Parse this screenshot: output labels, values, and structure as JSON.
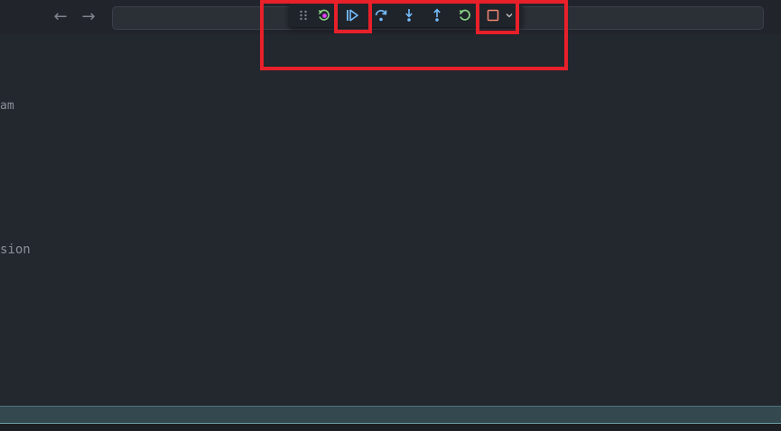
{
  "titlebar": {
    "back_icon": "arrow-left-icon",
    "forward_icon": "arrow-right-icon",
    "search_value": ""
  },
  "debug_toolbar": {
    "buttons": [
      {
        "id": "gripper",
        "icon": "gripper-dots-icon",
        "color": "#7f848e"
      },
      {
        "id": "restart-frame",
        "icon": "restart-frame-icon",
        "color": "#89d185",
        "accent": "#e040fb"
      },
      {
        "id": "continue",
        "icon": "continue-icon",
        "color": "#75beff"
      },
      {
        "id": "step-over",
        "icon": "step-over-icon",
        "color": "#75beff"
      },
      {
        "id": "step-into",
        "icon": "step-into-icon",
        "color": "#75beff"
      },
      {
        "id": "step-out",
        "icon": "step-out-icon",
        "color": "#75beff"
      },
      {
        "id": "restart",
        "icon": "restart-icon",
        "color": "#89d185"
      },
      {
        "id": "stop",
        "icon": "stop-icon",
        "color": "#f48771"
      },
      {
        "id": "stop-dropdown",
        "icon": "chevron-down-icon",
        "color": "#c5c5c5"
      }
    ]
  },
  "editor": {
    "line_1": "am",
    "line_2": "sion"
  },
  "colors": {
    "background": "#23272e",
    "highlight": "#e8202a",
    "statusbar": "#33494f"
  }
}
